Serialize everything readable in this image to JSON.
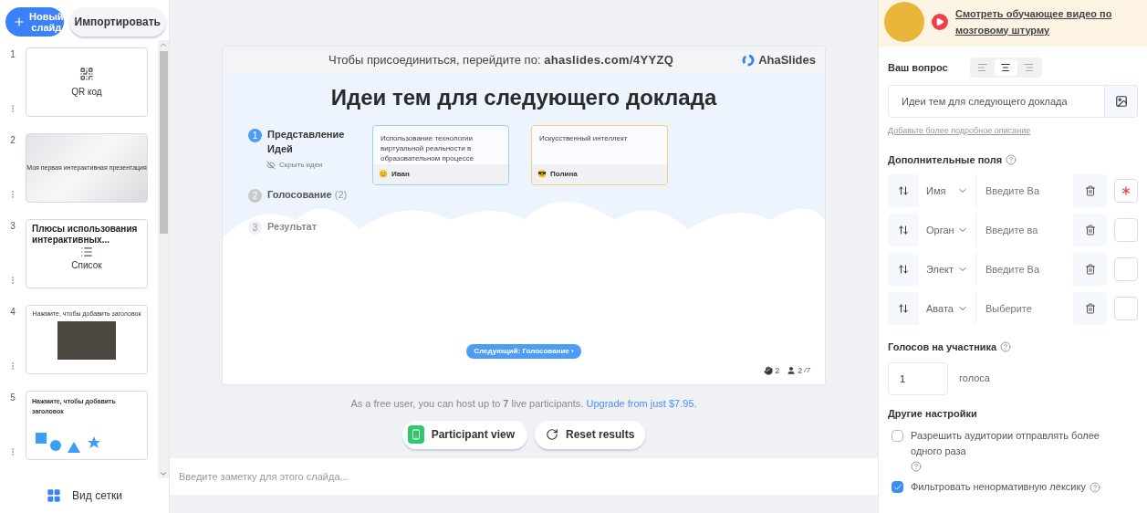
{
  "toolbar": {
    "new_slide": "Новый слайд",
    "import": "Импортировать"
  },
  "slides": [
    {
      "number": "1",
      "kind": "qr",
      "title": "QR код",
      "selected": false
    },
    {
      "number": "2",
      "kind": "cover",
      "title": "Моя первая интерактивная презентация",
      "selected": false
    },
    {
      "number": "3",
      "kind": "list",
      "title": "Плюсы использования интерактивных...",
      "subtitle": "Список",
      "selected": false
    },
    {
      "number": "4",
      "kind": "image",
      "title": "Нажмите, чтобы добавить заголовок",
      "selected": false
    },
    {
      "number": "5",
      "kind": "shapes",
      "title": "Нажмите, чтобы добавить заголовок",
      "selected": false
    }
  ],
  "grid_view": "Вид сетки",
  "preview": {
    "join_text": "Чтобы присоединиться, перейдите по:",
    "join_url": "ahaslides.com/4YYZQ",
    "brand": "AhaSlides",
    "title": "Идеи тем для следующего доклада",
    "steps": [
      {
        "number": "1",
        "label": "Представление Идей",
        "active": true
      },
      {
        "number": "2",
        "label": "Голосование",
        "count": "(2)",
        "active": false
      },
      {
        "number": "3",
        "label": "Результат",
        "active": false
      }
    ],
    "hide_ideas": "Скрыть идеи",
    "ideas": [
      {
        "text": "Использование технологии виртуальной реальности в образовательном процессе",
        "author": "Иван",
        "emoji": "😊",
        "color": "#9fcdf5"
      },
      {
        "text": "Искусственный интеллект",
        "author": "Полина",
        "emoji": "😎",
        "color": "#f3cf7a"
      }
    ],
    "next": "Следующий: Голосование ›",
    "hands": "2",
    "participants": "2",
    "participants_max": "/7"
  },
  "notice": {
    "text": "As a free user, you can host up to **7** live participants.",
    "link": "Upgrade from just $7.95."
  },
  "buttons": {
    "participant_view": "Participant view",
    "reset": "Reset results"
  },
  "notes": {
    "placeholder": "Введите заметку для этого слайда..."
  },
  "settings": {
    "video_link": "Смотреть обучающее видео по мозговому штурму",
    "question_label": "Ваш вопрос",
    "align": [
      {
        "kind": "left",
        "selected": false
      },
      {
        "kind": "center",
        "selected": true
      },
      {
        "kind": "right",
        "selected": false
      }
    ],
    "question": "Идеи тем для следующего доклада",
    "add_description": "Добавьте более подробное описание",
    "fields_label": "Дополнительные поля",
    "fields": [
      {
        "label": "Имя",
        "placeholder": "Введите Ва",
        "required": true
      },
      {
        "label": "Орган",
        "placeholder": "Введите ва",
        "required": false
      },
      {
        "label": "Элект",
        "placeholder": "Введите Ва",
        "required": false
      },
      {
        "label": "Авата",
        "placeholder": "Выберите",
        "required": false
      }
    ],
    "votes_label": "Голосов на участника",
    "votes": "1",
    "votes_unit": "голоса",
    "other_label": "Другие настройки",
    "options": [
      {
        "label": "Разрешить аудитории отправлять более одного раза",
        "checked": false,
        "help_below": true
      },
      {
        "label": "Фильтровать ненормативную лексику",
        "checked": true,
        "help_below": false
      }
    ]
  }
}
